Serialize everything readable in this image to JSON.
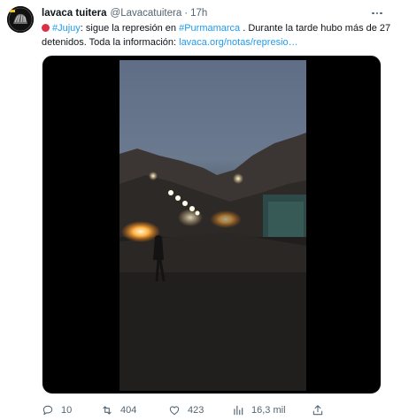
{
  "tweet": {
    "display_name": "lavaca tuitera",
    "handle": "@Lavacatuitera",
    "separator": "·",
    "time": "17h",
    "text": {
      "hashtag1": "#Jujuy",
      "part1": ": sigue la represión en ",
      "hashtag2": "#Purmamarca",
      "part2": " . Durante la tarde hubo más de 27 detenidos. Toda la información: ",
      "link": "lavaca.org/notas/represio…"
    },
    "media": {
      "type": "video",
      "description_icon": "video-player"
    },
    "actions": {
      "reply_count": "10",
      "retweet_count": "404",
      "like_count": "423",
      "views_count": "16,3 mil"
    }
  },
  "colors": {
    "accent": "#1d9bf0",
    "secondary_text": "#536471",
    "primary_text": "#0f1419",
    "red_circle": "#dd2e44"
  },
  "icons": [
    "more-icon",
    "red-circle-icon",
    "reply-icon",
    "retweet-icon",
    "like-icon",
    "views-icon",
    "share-icon"
  ]
}
